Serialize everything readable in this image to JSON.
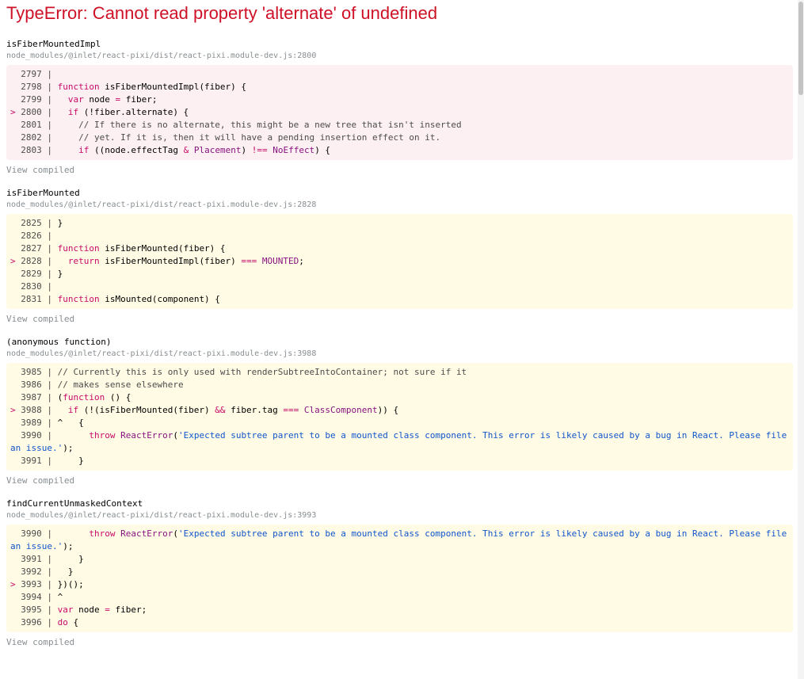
{
  "error": {
    "title": "TypeError: Cannot read property 'alternate' of undefined"
  },
  "frames": [
    {
      "name": "isFiberMountedImpl",
      "location": "node_modules/@inlet/react-pixi/dist/react-pixi.module-dev.js:2800",
      "view_compiled": "View compiled",
      "variant": "error",
      "lines": [
        "  2797 | ",
        "  2798 | function isFiberMountedImpl(fiber) {",
        "  2799 |   var node = fiber;",
        "> 2800 |   if (!fiber.alternate) {",
        "  2801 |     // If there is no alternate, this might be a new tree that isn't inserted",
        "  2802 |     // yet. If it is, then it will have a pending insertion effect on it.",
        "  2803 |     if ((node.effectTag & Placement) !== NoEffect) {"
      ]
    },
    {
      "name": "isFiberMounted",
      "location": "node_modules/@inlet/react-pixi/dist/react-pixi.module-dev.js:2828",
      "view_compiled": "View compiled",
      "variant": "warn",
      "lines": [
        "  2825 | }",
        "  2826 | ",
        "  2827 | function isFiberMounted(fiber) {",
        "> 2828 |   return isFiberMountedImpl(fiber) === MOUNTED;",
        "  2829 | }",
        "  2830 | ",
        "  2831 | function isMounted(component) {"
      ]
    },
    {
      "name": "(anonymous function)",
      "location": "node_modules/@inlet/react-pixi/dist/react-pixi.module-dev.js:3988",
      "view_compiled": "View compiled",
      "variant": "warn",
      "lines": [
        "  3985 | // Currently this is only used with renderSubtreeIntoContainer; not sure if it",
        "  3986 | // makes sense elsewhere",
        "  3987 | (function () {",
        "> 3988 |   if (!(isFiberMounted(fiber) && fiber.tag === ClassComponent)) {",
        "  3989 | ^   {",
        "  3990 |       throw ReactError('Expected subtree parent to be a mounted class component. This error is likely caused by a bug in React. Please file an issue.');",
        "  3991 |     }"
      ]
    },
    {
      "name": "findCurrentUnmaskedContext",
      "location": "node_modules/@inlet/react-pixi/dist/react-pixi.module-dev.js:3993",
      "view_compiled": "View compiled",
      "variant": "warn",
      "lines": [
        "  3990 |       throw ReactError('Expected subtree parent to be a mounted class component. This error is likely caused by a bug in React. Please file an issue.');",
        "  3991 |     }",
        "  3992 |   }",
        "> 3993 | })();",
        "  3994 | ^",
        "  3995 | var node = fiber;",
        "  3996 | do {"
      ]
    }
  ]
}
